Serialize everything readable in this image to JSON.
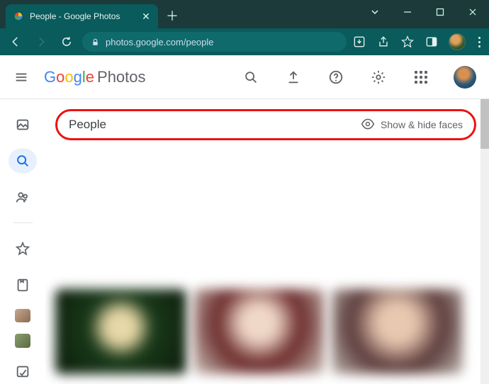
{
  "window": {
    "tab_title": "People - Google Photos",
    "url_display": "photos.google.com/people"
  },
  "header": {
    "product_name": "Photos",
    "google_letters": [
      "G",
      "o",
      "o",
      "g",
      "l",
      "e"
    ]
  },
  "sidebar": {
    "items": [
      {
        "name": "photos"
      },
      {
        "name": "search",
        "active": true
      },
      {
        "name": "sharing"
      }
    ],
    "secondary": [
      {
        "name": "favorites"
      },
      {
        "name": "albums"
      }
    ]
  },
  "page": {
    "title": "People",
    "show_hide_label": "Show & hide faces"
  }
}
